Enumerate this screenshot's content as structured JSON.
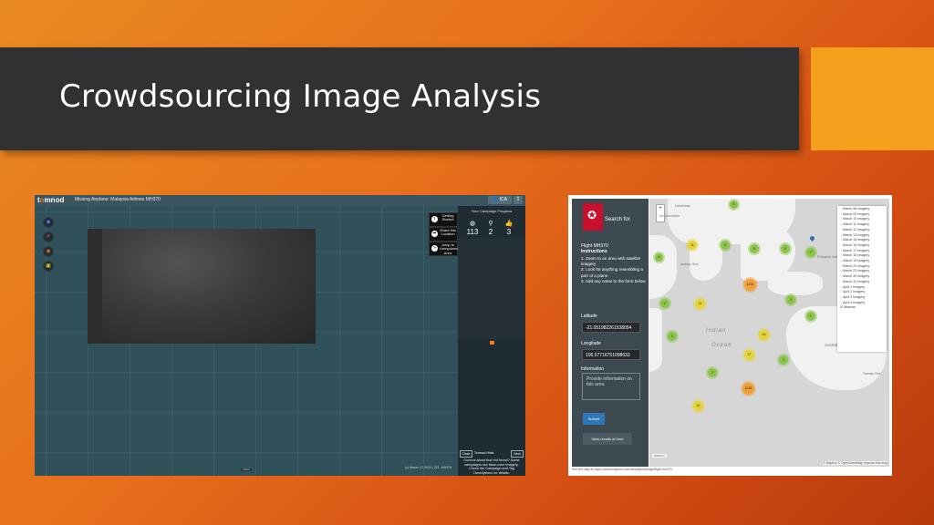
{
  "slide": {
    "title": "Crowdsourcing Image Analysis",
    "colors": {
      "title_bar": "#313131",
      "accent": "#f5a01c",
      "background_from": "#ea8a22",
      "background_to": "#b73a0e"
    }
  },
  "tomnod": {
    "logo_prefix": "t",
    "logo_accent": "o",
    "logo_suffix": "mnod",
    "campaign_title": "Missing Airplane: Malaysia Airlines MH370",
    "user_label": "ICA",
    "tools": [
      {
        "icon": "location-pin-icon",
        "glyph": "◆",
        "color": "#7b5cff"
      },
      {
        "icon": "plane-icon",
        "glyph": "✈",
        "color": "#e0452f"
      },
      {
        "icon": "life-ring-icon",
        "glyph": "◉",
        "color": "#e8661f"
      },
      {
        "icon": "fuel-icon",
        "glyph": "▣",
        "color": "#e3c21a"
      }
    ],
    "actions": [
      {
        "icon": "info-icon",
        "glyph": "i",
        "label": "Getting Started"
      },
      {
        "icon": "share-icon",
        "glyph": "➦",
        "label": "Share this Location"
      },
      {
        "icon": "jump-icon",
        "glyph": "»",
        "label": "Jump to Unexplored Area"
      }
    ],
    "progress_title": "Your Campaign Progress",
    "progress": [
      {
        "icon": "globe-icon",
        "glyph": "◍",
        "value": "113"
      },
      {
        "icon": "pin-icon",
        "glyph": "⚲",
        "value": "2"
      },
      {
        "icon": "thumbs-up-icon",
        "glyph": "👍",
        "value": "3"
      }
    ],
    "close_label": "Close",
    "tips_label": "Tomnod Hints",
    "next_label": "Next",
    "tip_text": "Curious about that red forest? Some campaigns use false-color imagery. Check the Campaign and Tag Descriptions for details.",
    "zoom_label": "zoom",
    "credit": "(c) Maxar | © 2021 | 221 ·MH370"
  },
  "mh370": {
    "search_label": "Search for",
    "heading": "Flight MH370",
    "instructions_heading": "Instructions",
    "instructions": "1. Zoom to an area with satellite imagery\n2. Look for anything resembling a part of a plane\n3. Add any notes to the form below",
    "latitude_label": "Latitude",
    "latitude_value": "-21.051982261538054",
    "longitude_label": "Longitude",
    "longitude_value": "106.57716751098633",
    "information_label": "Information",
    "information_placeholder": "Provide information on this area.",
    "submit_label": "Submit",
    "results_label": "View results of form",
    "seas": [
      "Indian",
      "Ocean"
    ],
    "places": [
      "Uzbekistan",
      "Turkmenistan",
      "Arabian Sea",
      "Philippine Sea",
      "Australia",
      "Tasman Sea"
    ],
    "clusters": [
      {
        "label": "8",
        "color": "g"
      },
      {
        "label": "11",
        "color": "y"
      },
      {
        "label": "4",
        "color": "g"
      },
      {
        "label": "5",
        "color": "g"
      },
      {
        "label": "6",
        "color": "g"
      },
      {
        "label": "3",
        "color": "g"
      },
      {
        "label": "7",
        "color": "g"
      },
      {
        "label": "1204",
        "color": "o"
      },
      {
        "label": "2",
        "color": "g"
      },
      {
        "label": "21",
        "color": "y"
      },
      {
        "label": "3",
        "color": "g"
      },
      {
        "label": "2",
        "color": "g"
      },
      {
        "label": "26",
        "color": "y"
      },
      {
        "label": "6",
        "color": "g"
      },
      {
        "label": "27",
        "color": "y"
      },
      {
        "label": "3",
        "color": "g"
      },
      {
        "label": "2",
        "color": "g"
      },
      {
        "label": "1038",
        "color": "o"
      },
      {
        "label": "19",
        "color": "y"
      }
    ],
    "legend": [
      "March 08 Imagery",
      "March 09 Imagery",
      "March 10 Imagery",
      "March 11 Imagery",
      "March 12 Imagery",
      "March 13 Imagery",
      "March 15 Imagery",
      "March 16 Imagery",
      "March 17 Imagery",
      "March 18 Imagery",
      "March 19 Imagery",
      "March 20 Imagery",
      "March 23 Imagery",
      "March 30 Imagery",
      "March 31 Imagery",
      "April 1 Imagery",
      "April 2 Imagery",
      "April 3 Imagery",
      "April 4 Imagery",
      "Markers"
    ],
    "attribution": "© Mapbox © OpenStreetMap Improve this map",
    "scale": "1000 km",
    "footer": "See full map at https://www.mapbox.com/labs/blackbridge/flight-mh370"
  }
}
